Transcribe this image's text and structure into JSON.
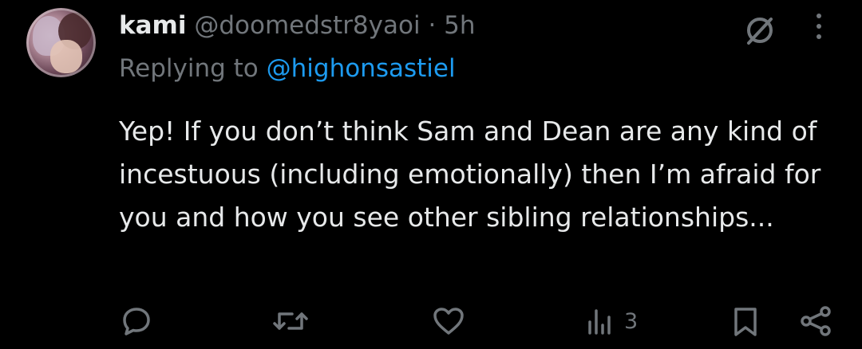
{
  "tweet": {
    "author_name": "kami",
    "author_handle": "@doomedstr8yaoi",
    "separator": "·",
    "time": "5h",
    "replying_prefix": "Replying to ",
    "replying_to": "@highonsastiel",
    "text": "Yep! If you don’t think Sam and Dean are any kind of incestuous (including emotionally) then I’m afraid for you and how you see other sibling relationships..."
  },
  "header_icons": [
    "grok-icon",
    "more-vertical-icon"
  ],
  "actions": {
    "reply": {
      "icon": "reply-icon"
    },
    "retweet": {
      "icon": "retweet-icon"
    },
    "like": {
      "icon": "heart-icon"
    },
    "views": {
      "icon": "views-chart-icon",
      "count": "3"
    },
    "bookmark": {
      "icon": "bookmark-icon"
    },
    "share": {
      "icon": "share-icon"
    }
  },
  "colors": {
    "background": "#000000",
    "text_primary": "#e7e9ea",
    "text_secondary": "#71767b",
    "accent": "#1d9bf0"
  }
}
